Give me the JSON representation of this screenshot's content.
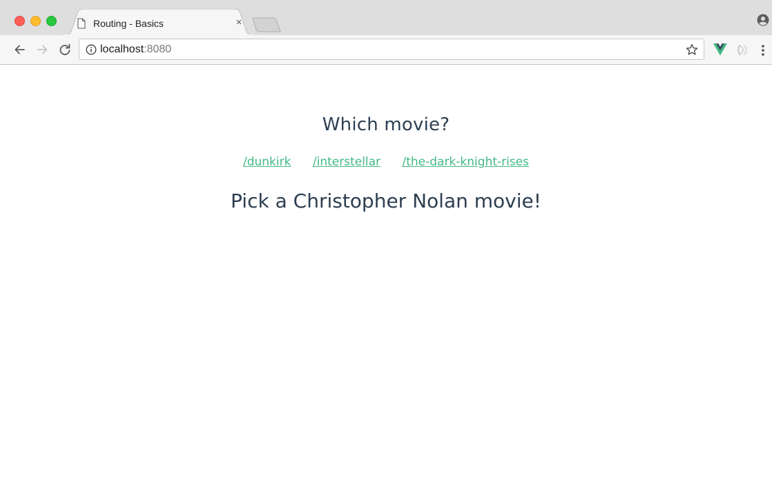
{
  "tab": {
    "title": "Routing - Basics",
    "close_glyph": "×"
  },
  "address_bar": {
    "host": "localhost",
    "port": ":8080"
  },
  "icons": {
    "page": "document-icon",
    "info": "info-icon",
    "bookmark": "star-icon",
    "extension_1": "vue-devtools-icon",
    "extension_2": "extension-icon",
    "menu": "more-vert-icon",
    "profile": "profile-icon"
  },
  "page": {
    "heading": "Which movie?",
    "links": [
      {
        "label": "/dunkirk"
      },
      {
        "label": "/interstellar"
      },
      {
        "label": "/the-dark-knight-rises"
      }
    ],
    "message": "Pick a Christopher Nolan movie!"
  },
  "colors": {
    "text": "#2c3e50",
    "link": "#42b983",
    "vue_green": "#41b883",
    "vue_dark": "#35495e"
  }
}
